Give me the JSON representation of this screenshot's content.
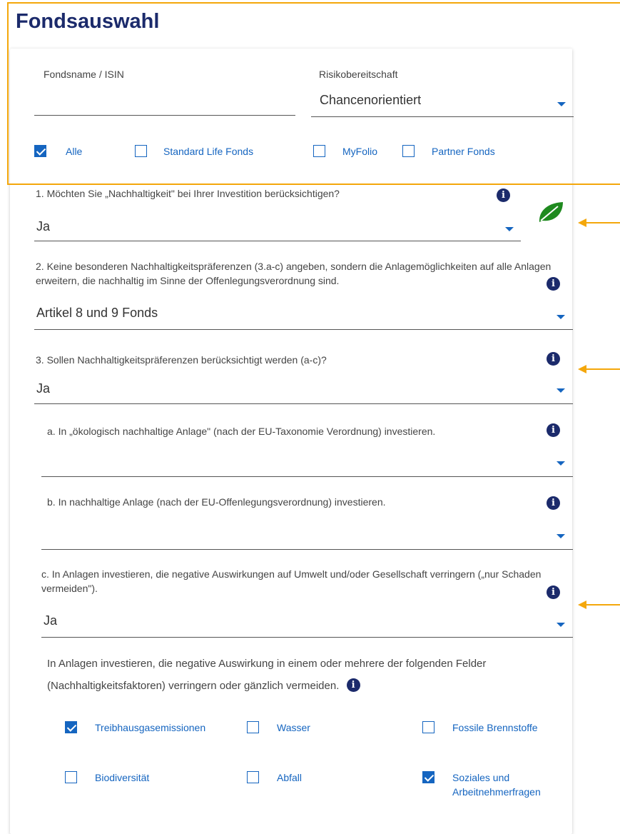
{
  "header": {
    "title": "Fondsauswahl"
  },
  "filters": {
    "fund_name_label": "Fondsname / ISIN",
    "fund_name_value": "",
    "risk_label": "Risikobereitschaft",
    "risk_value": "Chancenorientiert",
    "categories": [
      {
        "label": "Alle",
        "checked": true
      },
      {
        "label": "Standard Life Fonds",
        "checked": false
      },
      {
        "label": "MyFolio",
        "checked": false
      },
      {
        "label": "Partner Fonds",
        "checked": false
      }
    ]
  },
  "questions": {
    "q1": {
      "text": "1. Möchten Sie „Nachhaltigkeit\" bei Ihrer Investition berücksichtigen?",
      "value": "Ja"
    },
    "q2": {
      "text": "2. Keine besonderen Nachhaltigkeitspräferenzen (3.a-c) angeben, sondern die Anlagemöglichkeiten auf alle Anlagen erweitern, die nachhaltig im Sinne der Offenlegungsverordnung sind.",
      "value": "Artikel 8 und 9 Fonds"
    },
    "q3": {
      "text": "3. Sollen Nachhaltigkeitspräferenzen berücksichtigt werden (a-c)?",
      "value": "Ja"
    },
    "q3a": {
      "text": "a. In „ökologisch nachhaltige Anlage\" (nach der EU-Taxonomie Verordnung) investieren.",
      "value": ""
    },
    "q3b": {
      "text": "b. In nachhaltige Anlage (nach der EU-Offenlegungsverordnung) investieren.",
      "value": ""
    },
    "q3c": {
      "text": "c. In Anlagen investieren, die negative Auswirkungen auf Umwelt und/oder Gesellschaft verringern („nur Schaden vermeiden\").",
      "value": "Ja"
    }
  },
  "factors": {
    "intro": "In Anlagen investieren, die negative Auswirkung in einem oder mehrere der folgenden Felder (Nachhaltigkeitsfaktoren) verringern oder gänzlich vermeiden.",
    "items": [
      {
        "label": "Treibhausgasemissionen",
        "checked": true
      },
      {
        "label": "Wasser",
        "checked": false
      },
      {
        "label": "Fossile Brennstoffe",
        "checked": false
      },
      {
        "label": "Biodiversität",
        "checked": false
      },
      {
        "label": "Abfall",
        "checked": false
      },
      {
        "label": "Soziales und Arbeitnehmerfragen",
        "checked": true
      }
    ]
  },
  "icons": {
    "info": "info-icon",
    "leaf": "leaf-icon",
    "dropdown": "chevron-down-icon",
    "check": "checkmark-icon"
  },
  "colors": {
    "title": "#1b2a6b",
    "accent": "#1565c0",
    "highlight": "#f4a70b",
    "leaf": "#1f8a1f"
  }
}
